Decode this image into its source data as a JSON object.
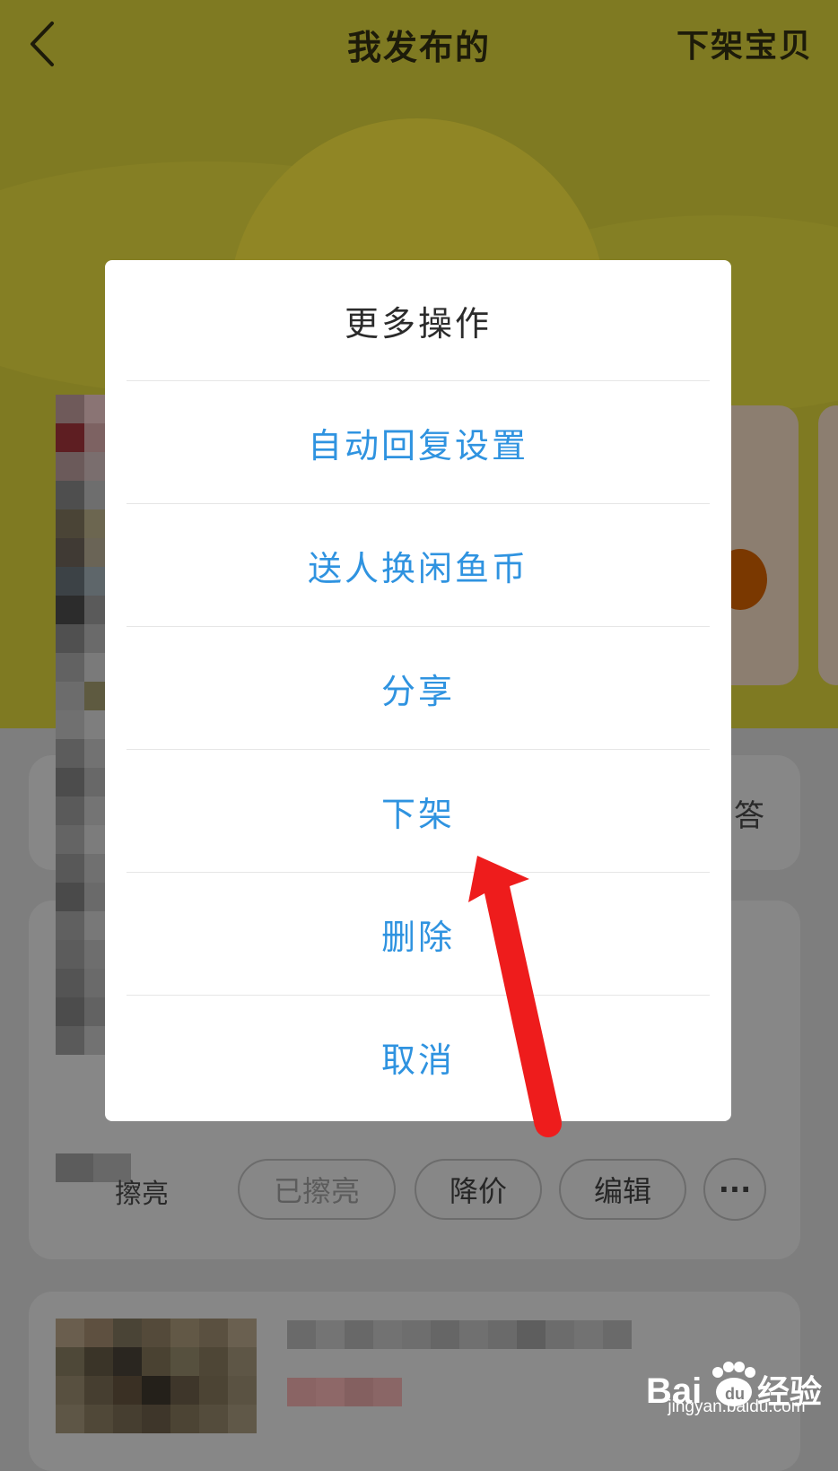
{
  "nav": {
    "title": "我发布的",
    "right_action": "下架宝贝"
  },
  "background": {
    "qa_text": "答",
    "shine_label": "擦亮",
    "actions": {
      "shined": "已擦亮",
      "reduce_price": "降价",
      "edit": "编辑",
      "more": "···"
    }
  },
  "dialog": {
    "title": "更多操作",
    "options": [
      "自动回复设置",
      "送人换闲鱼币",
      "分享",
      "下架",
      "删除",
      "取消"
    ]
  },
  "watermark": {
    "brand": "Bai",
    "brand_suffix": "经验",
    "url": "jingyan.baidu.com"
  },
  "colors": {
    "accent": "#2f93e0",
    "arrow": "#ee1c1c",
    "header": "#7f7a22"
  },
  "icons": [
    "back-chevron-icon",
    "more-icon",
    "red-arrow-annotation"
  ]
}
